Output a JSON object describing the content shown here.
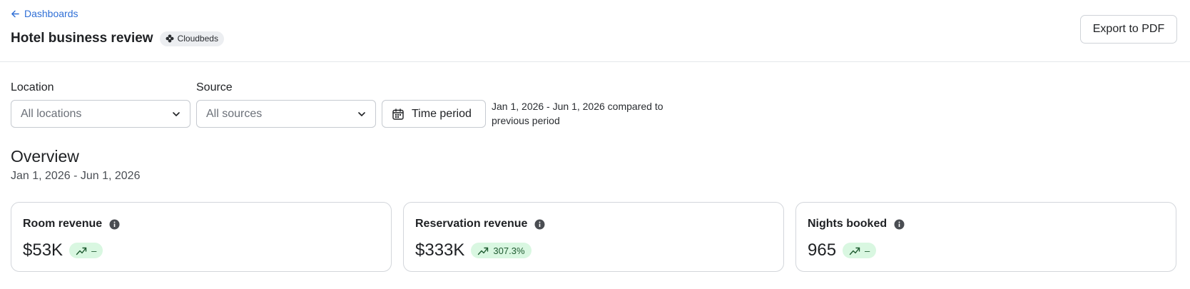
{
  "header": {
    "back_label": "Dashboards",
    "title": "Hotel business review",
    "badge": "Cloudbeds",
    "export_label": "Export to PDF"
  },
  "filters": {
    "location": {
      "label": "Location",
      "placeholder": "All locations"
    },
    "source": {
      "label": "Source",
      "placeholder": "All sources"
    },
    "time_button": "Time period",
    "period_text": "Jan 1, 2026 - Jun 1, 2026 compared to previous period"
  },
  "overview": {
    "title": "Overview",
    "date_range": "Jan 1, 2026 - Jun 1, 2026"
  },
  "cards": [
    {
      "label": "Room revenue",
      "value": "$53K",
      "delta": "–"
    },
    {
      "label": "Reservation revenue",
      "value": "$333K",
      "delta": "307.3%"
    },
    {
      "label": "Nights booked",
      "value": "965",
      "delta": "–"
    }
  ],
  "colors": {
    "link": "#2f6fd6",
    "delta_bg": "#d9f7e1",
    "delta_text": "#1e5a30"
  },
  "icons": {
    "back": "arrow-left-icon",
    "badge": "cloudbeds-logo-icon",
    "chevron": "chevron-down-icon",
    "calendar": "calendar-icon",
    "info": "info-icon",
    "trend": "trend-up-icon"
  }
}
